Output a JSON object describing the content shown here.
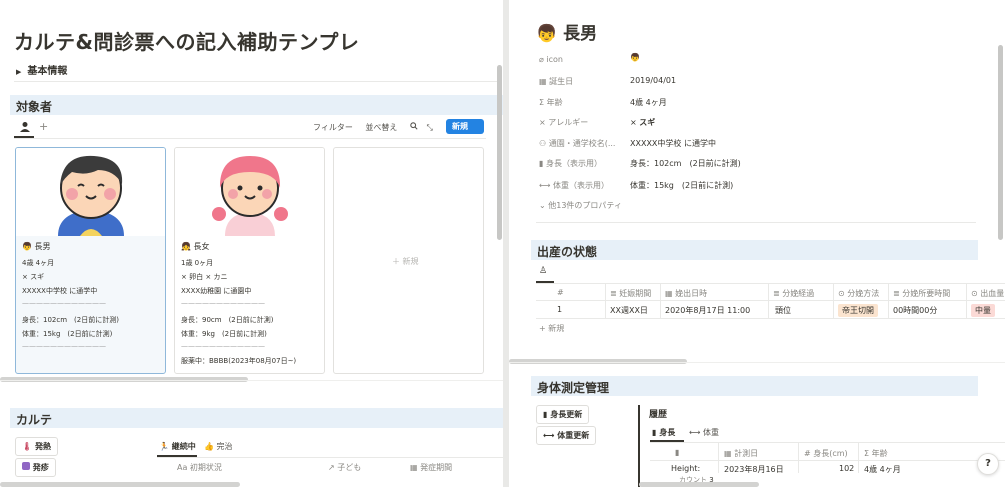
{
  "left": {
    "page_title": "カルテ&問診票への記入補助テンプレ",
    "basic_info_toggle": "基本情報",
    "subjects_section": "対象者",
    "toolbar": {
      "filter": "フィルター",
      "sort": "並べ替え",
      "new": "新規"
    },
    "cards": [
      {
        "name": "長男",
        "age": "4歳 4ヶ月",
        "allergy": "スギ",
        "school": "XXXXX中学校 に通学中",
        "sep1": "————————————",
        "height": "身長：102cm　(2日前に計測)",
        "weight": "体重：15kg　(2日前に計測)",
        "sep2": "————————————"
      },
      {
        "name": "長女",
        "age": "1歳 0ヶ月",
        "allergy1": "卵白",
        "allergy2": "カニ",
        "school": "XXXX幼稚園 に通園中",
        "sep1": "————————————",
        "height": "身長：90cm　(2日前に計測)",
        "weight": "体重：9kg　(2日前に計測)",
        "sep2": "————————————",
        "medication": "服薬中：BBBB(2023年08月07日~)"
      }
    ],
    "new_card": "＋ 新規",
    "karte_section": "カルテ",
    "karte_buttons": [
      "発熱",
      "発疹"
    ],
    "karte_tabs": [
      "継続中",
      "完治"
    ],
    "karte_columns": [
      "初期状況",
      "子ども",
      "発症期間"
    ]
  },
  "right": {
    "page_title": "長男",
    "properties": [
      {
        "label": "icon",
        "value": ""
      },
      {
        "label": "誕生日",
        "value": "2019/04/01"
      },
      {
        "label": "年齢",
        "value": "4歳 4ヶ月"
      },
      {
        "label": "アレルギー",
        "value": "スギ"
      },
      {
        "label": "通園・通学校名(...",
        "value": "XXXXX中学校 に通学中"
      },
      {
        "label": "身長（表示用）",
        "value": "身長：102cm　(2日前に計測)"
      },
      {
        "label": "体重（表示用）",
        "value": "体重：15kg　(2日前に計測)"
      }
    ],
    "more_props": "他13件のプロパティ",
    "birth_section": "出産の状態",
    "birth_columns": [
      "#",
      "妊娠期間",
      "娩出日時",
      "分娩経過",
      "分娩方法",
      "分娩所要時間",
      "出血量"
    ],
    "birth_row": {
      "no": "1",
      "period": "XX週XX日",
      "datetime": "2020年8月17日 11:00",
      "course": "頭位",
      "method": "帝王切開",
      "duration": "00時間00分",
      "bleeding": "中量"
    },
    "birth_new": "新規",
    "body_section": "身体測定管理",
    "body_buttons": [
      "身長更新",
      "体重更新"
    ],
    "history_title": "履歴",
    "history_tabs": [
      "身長",
      "体重"
    ],
    "history_columns": [
      "計測日",
      "身長(cm)",
      "年齢"
    ],
    "history_row": {
      "name": "Height:",
      "date": "2023年8月16日",
      "height": "102",
      "age": "4歳 4ヶ月"
    },
    "count_label": "カウント",
    "count_value": "3",
    "help": "?"
  },
  "colors": {
    "accent": "#2383e2",
    "section_bg": "#e7f0f8",
    "tag_orange": "#fbe4cf",
    "tag_red": "#fbdad6"
  }
}
